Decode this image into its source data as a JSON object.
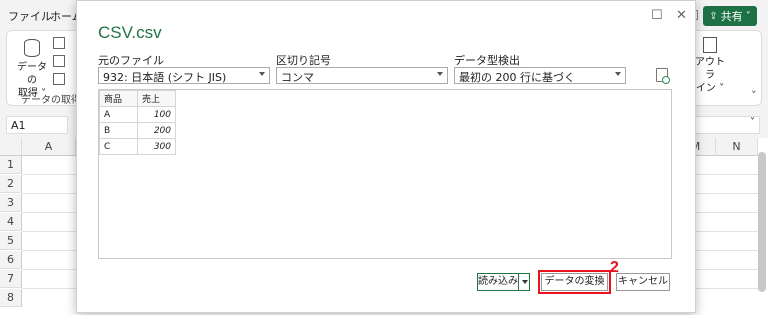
{
  "excel": {
    "ribbon_tabs": [
      "ファイル",
      "ホーム"
    ],
    "share_label": "共有",
    "ribbon": {
      "get_data_line1": "データの",
      "get_data_line2": "取得 ˅",
      "group_label": "データの取得と",
      "right_label_line1": "アウトラ",
      "right_label_line2": "イン ˅"
    },
    "name_box": "A1",
    "columns": [
      "A",
      "M",
      "N"
    ],
    "rows": [
      "1",
      "2",
      "3",
      "4",
      "5",
      "6",
      "7",
      "8"
    ]
  },
  "dialog": {
    "title": "CSV.csv",
    "file_origin": {
      "label": "元のファイル",
      "value": "932: 日本語 (シフト JIS)"
    },
    "delimiter": {
      "label": "区切り記号",
      "value": "コンマ"
    },
    "data_type_detection": {
      "label": "データ型検出",
      "value": "最初の 200 行に基づく"
    },
    "preview": {
      "headers": [
        "商品",
        "売上"
      ],
      "rows": [
        [
          "A",
          "100"
        ],
        [
          "B",
          "200"
        ],
        [
          "C",
          "300"
        ]
      ]
    },
    "buttons": {
      "load": "読み込み",
      "transform": "データの変換",
      "cancel": "キャンセル"
    },
    "step_marker": "2"
  },
  "colors": {
    "accent_green": "#217346",
    "share_green": "#1e7145",
    "highlight_red": "#e8111c"
  }
}
